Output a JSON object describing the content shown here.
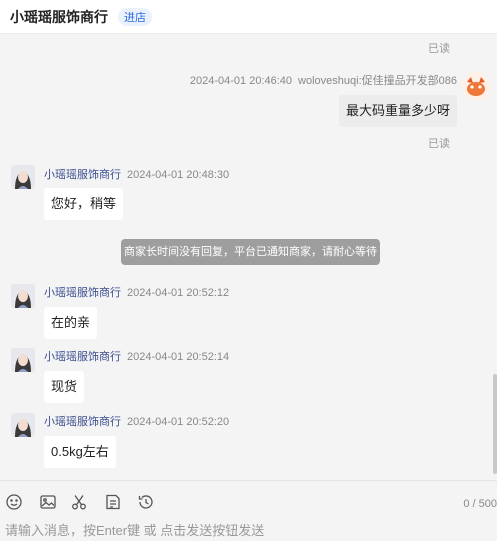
{
  "header": {
    "shop_name": "小瑶瑶服饰商行",
    "enter_label": "进店"
  },
  "messages": {
    "read_top": "已读",
    "m1": {
      "time": "2024-04-01 20:46:40",
      "sender": "woloveshuqi:促佳撞品开发部086",
      "text": "最大码重量多少呀",
      "read": "已读"
    },
    "m2": {
      "sender": "小瑶瑶服饰商行",
      "time": "2024-04-01 20:48:30",
      "text": "您好，稍等"
    },
    "notice": "商家长时间没有回复，平台已通知商家，请耐心等待",
    "m3": {
      "sender": "小瑶瑶服饰商行",
      "time": "2024-04-01 20:52:12",
      "text": "在的亲"
    },
    "m4": {
      "sender": "小瑶瑶服饰商行",
      "time": "2024-04-01 20:52:14",
      "text": "现货"
    },
    "m5": {
      "sender": "小瑶瑶服饰商行",
      "time": "2024-04-01 20:52:20",
      "text": "0.5kg左右"
    }
  },
  "toolbar": {
    "icons": [
      "emoji-icon",
      "image-icon",
      "scissors-icon",
      "order-icon",
      "history-icon"
    ],
    "counter": "0 / 500"
  },
  "input": {
    "placeholder": "请输入消息，按Enter键 或 点击发送按钮发送"
  }
}
